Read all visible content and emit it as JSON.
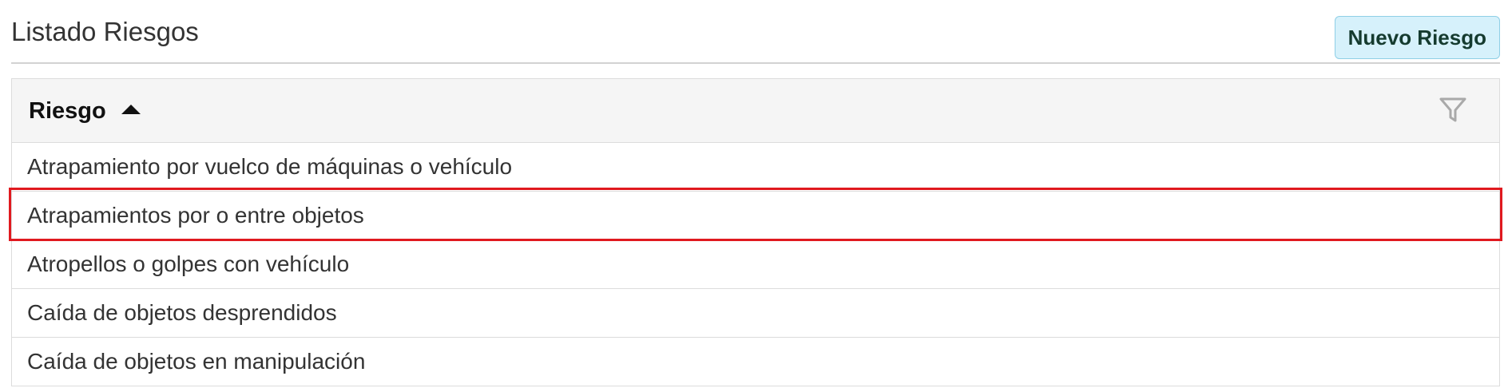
{
  "header": {
    "title": "Listado Riesgos",
    "new_button_label": "Nuevo Riesgo"
  },
  "grid": {
    "column": {
      "label": "Riesgo",
      "sort_icon": "sort-ascending-icon",
      "filter_icon": "filter-icon"
    },
    "rows": [
      {
        "label": "Atrapamiento por vuelco de máquinas o vehículo"
      },
      {
        "label": "Atrapamientos por o entre objetos"
      },
      {
        "label": "Atropellos o golpes con vehículo"
      },
      {
        "label": "Caída de objetos desprendidos"
      },
      {
        "label": "Caída de objetos en manipulación"
      }
    ],
    "highlighted_row_index": 1
  },
  "colors": {
    "button_bg": "#d6f1fb",
    "button_border": "#8fcfe6",
    "header_bg": "#f5f5f5",
    "highlight": "#e0191f"
  }
}
